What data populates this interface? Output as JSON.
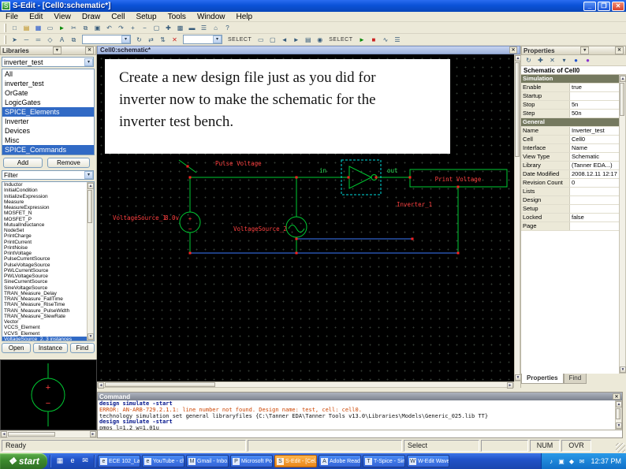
{
  "ui": {
    "close_glyph": "✕",
    "menu_glyph": "▾",
    "dropdown_glyph": "▾",
    "up_arrow": "▲",
    "down_arrow": "▼",
    "left_arrow": "◄",
    "right_arrow": "►"
  },
  "titlebar": {
    "app_initial": "S",
    "title": "S-Edit - [Cell0:schematic*]",
    "minimize_glyph": "_",
    "maximize_glyph": "❐",
    "close_glyph": "✕"
  },
  "menu": {
    "items": [
      "File",
      "Edit",
      "View",
      "Draw",
      "Cell",
      "Setup",
      "Tools",
      "Window",
      "Help"
    ]
  },
  "toolbar1": {
    "icons": [
      {
        "name": "new-icon",
        "glyph": "□"
      },
      {
        "name": "open-icon",
        "glyph": "▤",
        "cls": "c-yellow"
      },
      {
        "name": "save-icon",
        "glyph": "▦",
        "cls": "c-blue"
      },
      {
        "name": "print-icon",
        "glyph": "▭"
      },
      {
        "name": "run-simulation-icon",
        "glyph": "►",
        "cls": "c-green"
      },
      {
        "name": "cut-icon",
        "glyph": "✂"
      },
      {
        "name": "copy-icon",
        "glyph": "⧉"
      },
      {
        "name": "paste-icon",
        "glyph": "▣"
      },
      {
        "name": "undo-icon",
        "glyph": "↶"
      },
      {
        "name": "redo-icon",
        "glyph": "↷"
      },
      {
        "name": "zoom-in-icon",
        "glyph": "+"
      },
      {
        "name": "zoom-out-icon",
        "glyph": "−"
      },
      {
        "name": "zoom-fit-icon",
        "glyph": "▢"
      },
      {
        "name": "pan-icon",
        "glyph": "✚"
      },
      {
        "name": "grid-icon",
        "glyph": "▩"
      },
      {
        "name": "ruler-icon",
        "glyph": "▬"
      },
      {
        "name": "properties-icon",
        "glyph": "☰"
      },
      {
        "name": "home-view-icon",
        "glyph": "⌂"
      },
      {
        "name": "help-icon",
        "glyph": "?"
      }
    ]
  },
  "toolbar2": {
    "icons_a": [
      {
        "name": "select-tool-icon",
        "glyph": "➤"
      },
      {
        "name": "wire-tool-icon",
        "glyph": "─"
      },
      {
        "name": "bus-tool-icon",
        "glyph": "═"
      },
      {
        "name": "symbol-tool-icon",
        "glyph": "◇"
      },
      {
        "name": "text-tool-icon",
        "glyph": "A"
      },
      {
        "name": "instance-tool-icon",
        "glyph": "⧉"
      }
    ],
    "combo1": "",
    "icons_b": [
      {
        "name": "rotate-icon",
        "glyph": "↻"
      },
      {
        "name": "flip-h-icon",
        "glyph": "⇄"
      },
      {
        "name": "flip-v-icon",
        "glyph": "⇅"
      },
      {
        "name": "delete-icon",
        "glyph": "✕",
        "cls": "c-red"
      }
    ],
    "combo2": "",
    "mode_label_1": "SELECT",
    "icons_c": [
      {
        "name": "zoom-area-icon",
        "glyph": "▭"
      },
      {
        "name": "zoom-sel-icon",
        "glyph": "▢"
      },
      {
        "name": "prev-view-icon",
        "glyph": "◄"
      },
      {
        "name": "next-view-icon",
        "glyph": "►"
      },
      {
        "name": "layers-icon",
        "glyph": "▤"
      },
      {
        "name": "probe-icon",
        "glyph": "◉"
      }
    ],
    "mode_label_2": "SELECT",
    "icons_d": [
      {
        "name": "start-sim-icon",
        "glyph": "►",
        "cls": "c-green"
      },
      {
        "name": "stop-sim-icon",
        "glyph": "■",
        "cls": "c-red"
      },
      {
        "name": "waveform-icon",
        "glyph": "∿"
      },
      {
        "name": "settings-icon",
        "glyph": "☰"
      }
    ]
  },
  "libraries": {
    "caption": "Libraries",
    "design_combo": "inverter_test",
    "library_list": [
      {
        "label": "All"
      },
      {
        "label": "inverter_test"
      },
      {
        "label": "OrGate"
      },
      {
        "label": "LogicGates"
      },
      {
        "label": "SPICE_Elements",
        "selected": true
      },
      {
        "label": "Inverter"
      },
      {
        "label": "Devices"
      },
      {
        "label": "Misc"
      },
      {
        "label": "SPICE_Commands",
        "selected": true
      }
    ],
    "add_button": "Add",
    "remove_button": "Remove",
    "filter_combo": "Filter",
    "cell_list": [
      {
        "label": "Inductor"
      },
      {
        "label": "InitialCondition"
      },
      {
        "label": "InitializeExpression"
      },
      {
        "label": "Measure"
      },
      {
        "label": "MeasureExpression"
      },
      {
        "label": "MOSFET_N"
      },
      {
        "label": "MOSFET_P"
      },
      {
        "label": "MutualInductance"
      },
      {
        "label": "NodeSet"
      },
      {
        "label": "PrintCharge"
      },
      {
        "label": "PrintCurrent"
      },
      {
        "label": "PrintNoise"
      },
      {
        "label": "PrintVoltage"
      },
      {
        "label": "PulseCurrentSource"
      },
      {
        "label": "PulseVoltageSource"
      },
      {
        "label": "PWLCurrentSource"
      },
      {
        "label": "PWLVoltageSource"
      },
      {
        "label": "SineCurrentSource"
      },
      {
        "label": "SineVoltageSource"
      },
      {
        "label": "TRAN_Measure_Delay"
      },
      {
        "label": "TRAN_Measure_FallTime"
      },
      {
        "label": "TRAN_Measure_RiseTime"
      },
      {
        "label": "TRAN_Measure_PulseWidth"
      },
      {
        "label": "TRAN_Measure_SlewRate"
      },
      {
        "label": "Vector"
      },
      {
        "label": "VCCS_Element"
      },
      {
        "label": "VCVS_Element"
      },
      {
        "label": "VoltageSource_2, 3 instances",
        "selected": true
      }
    ],
    "open_button": "Open",
    "instance_button": "Instance",
    "find_button": "Find"
  },
  "preview": {
    "plus": "+",
    "minus": "−"
  },
  "schematic": {
    "window_title": "Cell0:schematic*",
    "slide_lines": [
      "Create a new design file just as you did for",
      "inverter now to make the schematic for the",
      "inverter test bench."
    ],
    "labels": {
      "pulse_voltage": "Pulse Voltage",
      "vs1_name": "VoltageSource_1",
      "vs1_value": "8.0v",
      "vs2_name": "VoltageSource_2",
      "node_in": "in",
      "node_out": "out",
      "print_voltage": "Print Voltage",
      "inverter_name": "Inverter_1",
      "plus": "+",
      "minus": "−"
    }
  },
  "properties": {
    "caption": "Properties",
    "toolbar_icons": [
      {
        "name": "refresh-icon",
        "glyph": "↻"
      },
      {
        "name": "new-property-icon",
        "glyph": "✚"
      },
      {
        "name": "delete-property-icon",
        "glyph": "✕"
      },
      {
        "name": "sort-icon",
        "glyph": "▾"
      },
      {
        "name": "blue-dot-icon",
        "glyph": "●",
        "cls": "c-blue"
      },
      {
        "name": "purple-dot-icon",
        "glyph": "●",
        "cls": "c-purple"
      }
    ],
    "subtitle": "Schematic of Cell0",
    "grid": [
      {
        "name": "Simulation",
        "value": "",
        "cls": "section"
      },
      {
        "name": "Enable",
        "value": "true"
      },
      {
        "name": "Startup",
        "value": ""
      },
      {
        "name": "Stop",
        "value": "5n"
      },
      {
        "name": "Step",
        "value": "50n"
      },
      {
        "name": "General",
        "value": "",
        "cls": "section"
      },
      {
        "name": "Name",
        "value": "Inverter_test"
      },
      {
        "name": "Cell",
        "value": "Cell0"
      },
      {
        "name": "Interface",
        "value": "Name"
      },
      {
        "name": "View Type",
        "value": "Schematic"
      },
      {
        "name": "Library",
        "value": "(Tanner EDA...)"
      },
      {
        "name": "Date Modified",
        "value": "2008.12.11 12:17"
      },
      {
        "name": "Revision Count",
        "value": "0"
      },
      {
        "name": "Lists",
        "value": ""
      },
      {
        "name": "Design",
        "value": ""
      },
      {
        "name": "Setup",
        "value": ""
      },
      {
        "name": "Locked",
        "value": "false"
      },
      {
        "name": "Page",
        "value": ""
      }
    ],
    "tabs": [
      {
        "label": "Properties",
        "selected": true
      },
      {
        "label": "Find"
      }
    ]
  },
  "command": {
    "caption": "Command",
    "lines": [
      {
        "text": "design simulate -start",
        "cls": "cmd"
      },
      {
        "text": "ERROR: AN-ARB-729.2.1.1: line number not found. Design name: test, cell: cell0.",
        "cls": "error"
      },
      {
        "text": "technology simulation set general  libraryfiles {C:\\Tanner EDA\\Tanner Tools v13.0\\Libraries\\Models\\Generic_025.lib TT}",
        "cls": "plain"
      },
      {
        "text": "design simulate -start",
        "cls": "cmd"
      },
      {
        "text": "pmos l=1.2 w=1.01u",
        "cls": "plain"
      }
    ],
    "prompt": ""
  },
  "statusbar": {
    "ready": "Ready",
    "mode": "Select",
    "indicator1": "NUM",
    "indicator2": "OVR"
  },
  "taskbar": {
    "start_label": "start",
    "flag_glyph": "❖",
    "quick_launch": [
      {
        "name": "show-desktop-icon",
        "glyph": "▦"
      },
      {
        "name": "ie-icon",
        "glyph": "e"
      },
      {
        "name": "outlook-icon",
        "glyph": "✉"
      }
    ],
    "buttons": [
      {
        "label": "ECE 102_Lab...",
        "icon": "e"
      },
      {
        "label": "YouTube - ch...",
        "icon": "e"
      },
      {
        "label": "Gmail - Inbo...",
        "icon": "M"
      },
      {
        "label": "Microsoft Po...",
        "icon": "P"
      },
      {
        "label": "S-Edit - [Cel...",
        "icon": "S",
        "cls": "attention"
      },
      {
        "label": "Adobe Reade...",
        "icon": "A"
      },
      {
        "label": "T-Spice - Sim...",
        "icon": "T"
      },
      {
        "label": "W-Edit Wavef...",
        "icon": "W"
      }
    ],
    "tray": {
      "icons": [
        {
          "name": "volume-icon",
          "glyph": "♪"
        },
        {
          "name": "network-icon",
          "glyph": "▣"
        },
        {
          "name": "shield-icon",
          "glyph": "◆"
        },
        {
          "name": "mail-icon",
          "glyph": "✉"
        }
      ],
      "clock": "12:37 PM"
    }
  }
}
